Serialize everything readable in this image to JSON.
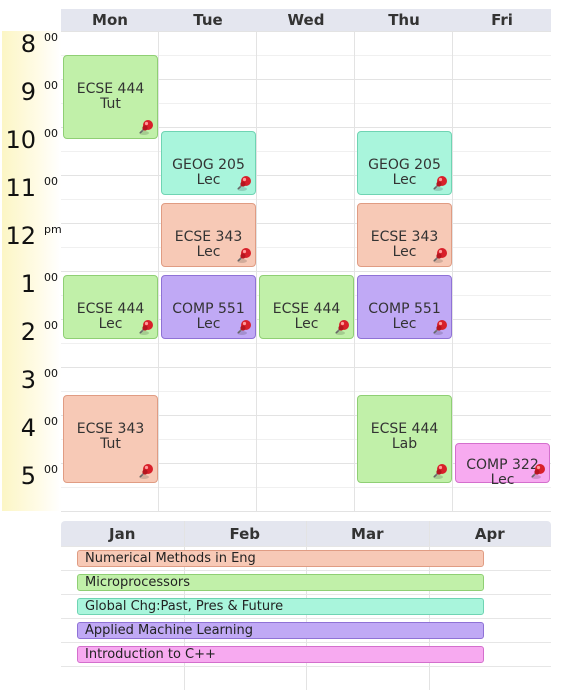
{
  "schedule": {
    "days": [
      "Mon",
      "Tue",
      "Wed",
      "Thu",
      "Fri"
    ],
    "hours": [
      {
        "hour": "8",
        "suffix": "00"
      },
      {
        "hour": "9",
        "suffix": "00"
      },
      {
        "hour": "10",
        "suffix": "00"
      },
      {
        "hour": "11",
        "suffix": "00"
      },
      {
        "hour": "12",
        "suffix": "pm"
      },
      {
        "hour": "1",
        "suffix": "00"
      },
      {
        "hour": "2",
        "suffix": "00"
      },
      {
        "hour": "3",
        "suffix": "00"
      },
      {
        "hour": "4",
        "suffix": "00"
      },
      {
        "hour": "5",
        "suffix": "00"
      }
    ],
    "events": [
      {
        "title": "ECSE 444",
        "type": "Tut",
        "day": "Mon",
        "start": "8:30",
        "end": "10:15",
        "color": "#c1f0a9",
        "border": "#8fcf74"
      },
      {
        "title": "GEOG 205",
        "type": "Lec",
        "day": "Tue",
        "start": "10:05",
        "end": "11:25",
        "color": "#a9f5dc",
        "border": "#6fd4b3"
      },
      {
        "title": "GEOG 205",
        "type": "Lec",
        "day": "Thu",
        "start": "10:05",
        "end": "11:25",
        "color": "#a9f5dc",
        "border": "#6fd4b3"
      },
      {
        "title": "ECSE 343",
        "type": "Lec",
        "day": "Tue",
        "start": "11:35",
        "end": "12:55",
        "color": "#f7c9b6",
        "border": "#e09c83"
      },
      {
        "title": "ECSE 343",
        "type": "Lec",
        "day": "Thu",
        "start": "11:35",
        "end": "12:55",
        "color": "#f7c9b6",
        "border": "#e09c83"
      },
      {
        "title": "ECSE 444",
        "type": "Lec",
        "day": "Mon",
        "start": "13:05",
        "end": "14:25",
        "color": "#c1f0a9",
        "border": "#8fcf74"
      },
      {
        "title": "COMP 551",
        "type": "Lec",
        "day": "Tue",
        "start": "13:05",
        "end": "14:25",
        "color": "#c0a9f5",
        "border": "#8f72d6"
      },
      {
        "title": "ECSE 444",
        "type": "Lec",
        "day": "Wed",
        "start": "13:05",
        "end": "14:25",
        "color": "#c1f0a9",
        "border": "#8fcf74"
      },
      {
        "title": "COMP 551",
        "type": "Lec",
        "day": "Thu",
        "start": "13:05",
        "end": "14:25",
        "color": "#c0a9f5",
        "border": "#8f72d6"
      },
      {
        "title": "ECSE 343",
        "type": "Tut",
        "day": "Mon",
        "start": "15:35",
        "end": "17:25",
        "color": "#f7c9b6",
        "border": "#e09c83"
      },
      {
        "title": "ECSE 444",
        "type": "Lab",
        "day": "Thu",
        "start": "15:35",
        "end": "17:25",
        "color": "#c1f0a9",
        "border": "#8fcf74"
      },
      {
        "title": "COMP 322",
        "type": "Lec",
        "day": "Fri",
        "start": "16:35",
        "end": "17:25",
        "color": "#f7aaf0",
        "border": "#d46fcd"
      }
    ]
  },
  "term": {
    "months": [
      "Jan",
      "Feb",
      "Mar",
      "Apr"
    ],
    "courses": [
      {
        "name": "Numerical Methods in Eng",
        "color": "#f7c9b6",
        "border": "#e09c83"
      },
      {
        "name": "Microprocessors",
        "color": "#c1f0a9",
        "border": "#8fcf74"
      },
      {
        "name": "Global Chg:Past, Pres & Future",
        "color": "#a9f5dc",
        "border": "#6fd4b3"
      },
      {
        "name": "Applied Machine Learning",
        "color": "#c0a9f5",
        "border": "#8f72d6"
      },
      {
        "name": "Introduction to C++",
        "color": "#f7aaf0",
        "border": "#d46fcd"
      }
    ]
  }
}
